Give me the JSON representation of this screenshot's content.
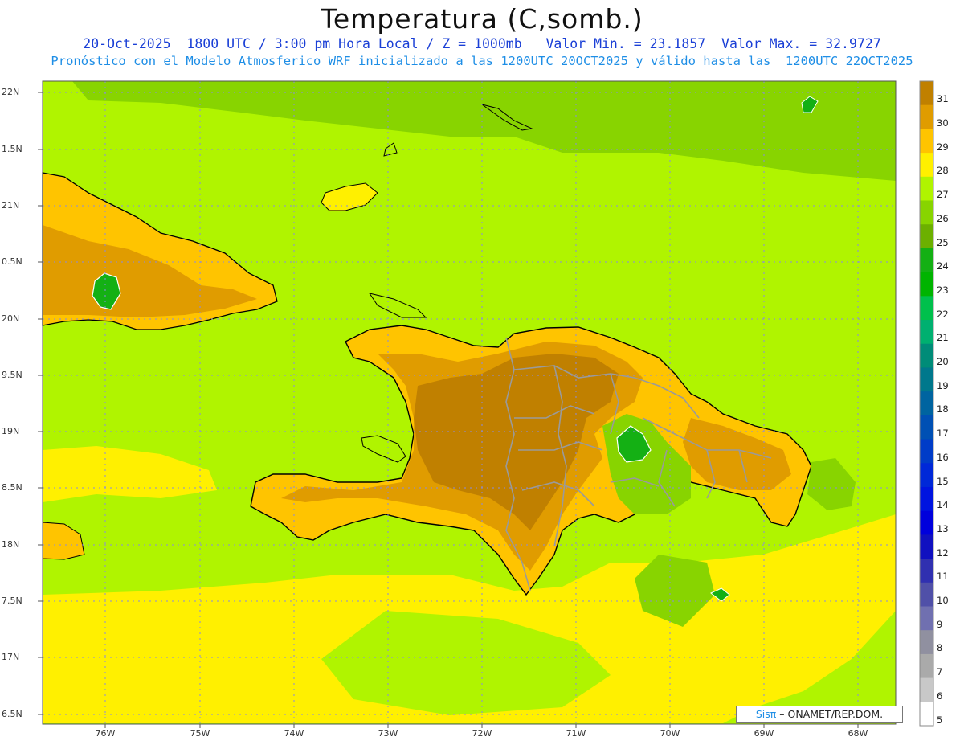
{
  "header": {
    "title": "Temperatura (C,somb.)",
    "line1": "20-Oct-2025  1800 UTC / 3:00 pm Hora Local / Z = 1000mb   Valor Min. = 23.1857  Valor Max. = 32.9727",
    "line2": "Pronóstico con el Modelo Atmosferico WRF inicializado a las 1200UTC_20OCT2025 y válido hasta las  1200UTC_22OCT2025"
  },
  "map": {
    "lat_labels": [
      "22N",
      "1.5N",
      "21N",
      "0.5N",
      "20N",
      "9.5N",
      "19N",
      "8.5N",
      "18N",
      "7.5N",
      "17N",
      "6.5N"
    ],
    "lon_labels": [
      "76W",
      "75W",
      "74W",
      "73W",
      "72W",
      "71W",
      "70W",
      "69W",
      "68W"
    ],
    "background_color": "#b0f400",
    "grid": "dotted"
  },
  "colorbar": {
    "levels": [
      "31",
      "30",
      "29",
      "28",
      "27",
      "26",
      "25",
      "24",
      "23",
      "22",
      "21",
      "20",
      "19",
      "18",
      "17",
      "16",
      "15",
      "14",
      "13",
      "12",
      "11",
      "10",
      "9",
      "8",
      "7",
      "6",
      "5"
    ],
    "colors": [
      "#c08000",
      "#e09c00",
      "#ffc400",
      "#fff000",
      "#b0f400",
      "#88d400",
      "#6cb000",
      "#14b014",
      "#00b400",
      "#00c04c",
      "#00b070",
      "#008c78",
      "#00788c",
      "#0064a0",
      "#0050b4",
      "#003cc8",
      "#0028d8",
      "#0014e0",
      "#0000dc",
      "#1010c0",
      "#3030b0",
      "#5050a8",
      "#7070b0",
      "#9090a0",
      "#aaaaaa",
      "#c8c8c8",
      "#ffffff"
    ]
  },
  "credit": {
    "brand": "Sisπ",
    "text": "– ONAMET/REP.DOM."
  }
}
